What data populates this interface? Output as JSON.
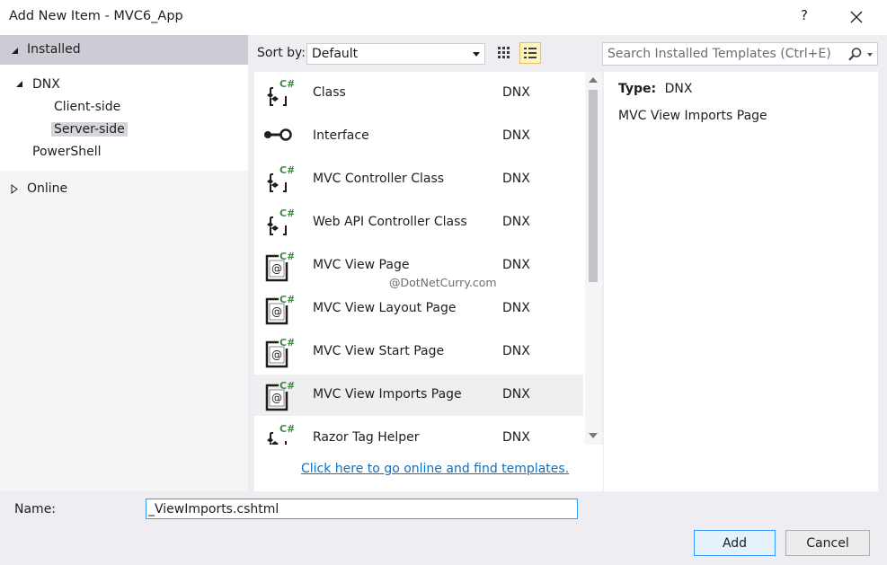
{
  "window": {
    "title": "Add New Item - MVC6_App",
    "help_label": "?"
  },
  "tree": {
    "header_label": "Installed",
    "items": [
      {
        "label": "DNX"
      },
      {
        "label": "Client-side"
      },
      {
        "label": "Server-side"
      },
      {
        "label": "PowerShell"
      }
    ],
    "online_label": "Online"
  },
  "toolbar": {
    "sort_label": "Sort by:",
    "sort_value": "Default"
  },
  "templates": [
    {
      "name": "Class",
      "type": "DNX",
      "icon": "csharp-class-icon"
    },
    {
      "name": "Interface",
      "type": "DNX",
      "icon": "interface-icon"
    },
    {
      "name": "MVC Controller Class",
      "type": "DNX",
      "icon": "csharp-class-icon"
    },
    {
      "name": "Web API Controller Class",
      "type": "DNX",
      "icon": "csharp-class-icon"
    },
    {
      "name": "MVC View Page",
      "type": "DNX",
      "icon": "razor-page-icon"
    },
    {
      "name": "MVC View Layout Page",
      "type": "DNX",
      "icon": "razor-page-icon"
    },
    {
      "name": "MVC View Start Page",
      "type": "DNX",
      "icon": "razor-page-icon"
    },
    {
      "name": "MVC View Imports Page",
      "type": "DNX",
      "icon": "razor-page-icon",
      "selected": true
    },
    {
      "name": "Razor Tag Helper",
      "type": "DNX",
      "icon": "csharp-class-icon"
    }
  ],
  "online_link": "Click here to go online and find templates.",
  "watermark": "@DotNetCurry.com",
  "search": {
    "placeholder": "Search Installed Templates (Ctrl+E)"
  },
  "details": {
    "type_label": "Type:",
    "type_value": "DNX",
    "description": "MVC View Imports Page"
  },
  "name_field": {
    "label": "Name:",
    "value": "_ViewImports.cshtml"
  },
  "buttons": {
    "add": "Add",
    "cancel": "Cancel"
  },
  "colors": {
    "accent": "#3399ff",
    "link": "#0e70c0",
    "csharp_green": "#3c8c3c"
  }
}
